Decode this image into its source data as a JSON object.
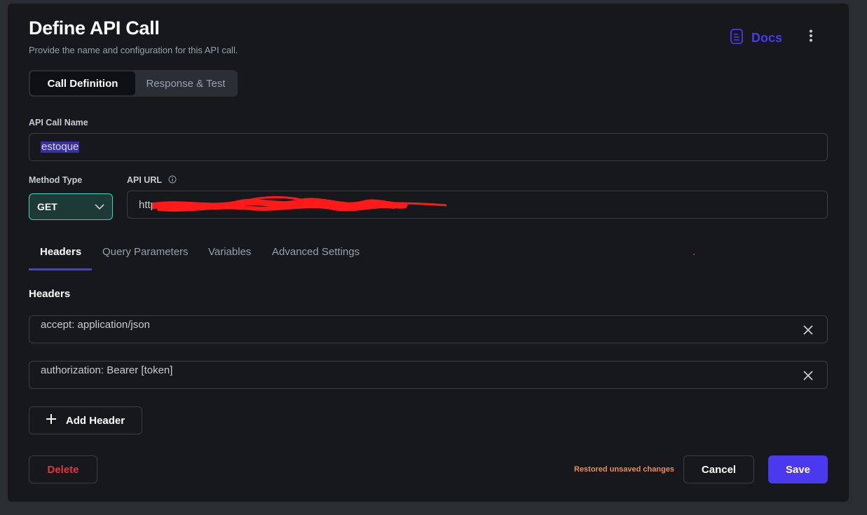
{
  "dialog": {
    "title": "Define API Call",
    "subtitle": "Provide the name and configuration for this API call.",
    "docs_label": "Docs",
    "docs_icon": "document-icon",
    "more_icon": "more-vertical-icon"
  },
  "segments": {
    "active": "Call Definition",
    "inactive": "Response & Test"
  },
  "form": {
    "name_label": "API Call Name",
    "name_value": "estoque",
    "method_label": "Method Type",
    "method_value": "GET",
    "url_label": "API URL",
    "url_value": "http",
    "url_info_icon": "info-icon"
  },
  "tabs": [
    {
      "label": "Headers",
      "active": true
    },
    {
      "label": "Query Parameters",
      "active": false
    },
    {
      "label": "Variables",
      "active": false
    },
    {
      "label": "Advanced Settings",
      "active": false
    }
  ],
  "headers_section": {
    "title": "Headers",
    "items": [
      {
        "text": "accept: application/json"
      },
      {
        "text": "authorization: Bearer [token]"
      }
    ],
    "add_label": "Add Header"
  },
  "footer": {
    "delete_label": "Delete",
    "status_text": "Restored unsaved changes",
    "cancel_label": "Cancel",
    "save_label": "Save"
  },
  "colors": {
    "accent": "#4b39ef",
    "method_border": "#39d2c0",
    "danger": "#e0383e",
    "warning_text": "#ee8b60",
    "panel_bg": "#16181c"
  }
}
